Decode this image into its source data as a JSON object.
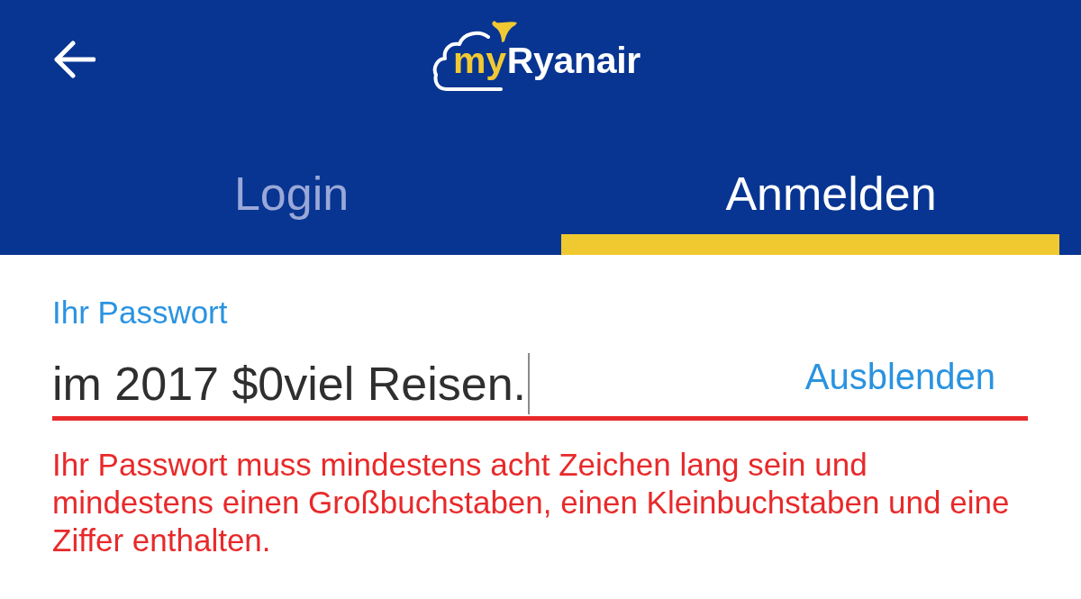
{
  "header": {
    "logo": {
      "prefix": "my",
      "name": "Ryanair"
    }
  },
  "tabs": [
    {
      "label": "Login",
      "selected": false
    },
    {
      "label": "Anmelden",
      "selected": true
    }
  ],
  "password_field": {
    "label": "Ihr Passwort",
    "value": "im 2017 $0viel Reisen.",
    "focused": true,
    "error": true,
    "toggle_label": "Ausblenden"
  },
  "error_message": "Ihr Passwort muss mindestens acht Zeichen lang sein und mindestens einen Großbuchstaben, einen Kleinbuchstaben und eine Ziffer enthalten."
}
